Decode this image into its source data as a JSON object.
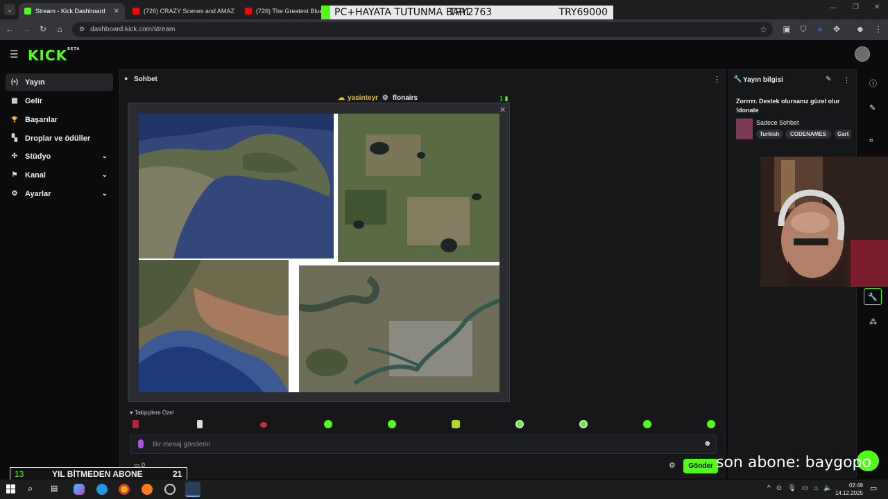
{
  "browser": {
    "tabs": [
      {
        "title": "Stream - Kick Dashboard",
        "active": true,
        "favicon_color": "#53fc18"
      },
      {
        "title": "(726) CRAZY Scenes and AMAZ",
        "active": false,
        "favicon_color": "#ff0000"
      },
      {
        "title": "(726) The Greatest Blues Ba",
        "active": false,
        "favicon_color": "#ff0000"
      }
    ],
    "url": "dashboard.kick.com/stream"
  },
  "overlay_top": {
    "left": "PC+HAYATA TUTUNMA BARI",
    "middle": "TRY2763",
    "right": "TRY69000"
  },
  "kick": {
    "logo": "KICK",
    "logo_badge": "BETA",
    "sidebar": [
      {
        "label": "Yayın",
        "icon": "broadcast-icon",
        "glyph": "(•)",
        "active": true,
        "expand": false
      },
      {
        "label": "Gelir",
        "icon": "revenue-icon",
        "glyph": "▦",
        "active": false,
        "expand": false
      },
      {
        "label": "Başarılar",
        "icon": "trophy-icon",
        "glyph": "🏆",
        "active": false,
        "expand": false
      },
      {
        "label": "Droplar ve ödüller",
        "icon": "drops-icon",
        "glyph": "▚",
        "active": false,
        "expand": false
      },
      {
        "label": "Stüdyo",
        "icon": "studio-icon",
        "glyph": "✣",
        "active": false,
        "expand": true
      },
      {
        "label": "Kanal",
        "icon": "channel-icon",
        "glyph": "⚑",
        "active": false,
        "expand": true
      },
      {
        "label": "Ayarlar",
        "icon": "settings-icon",
        "glyph": "⚙",
        "active": false,
        "expand": true
      }
    ],
    "chat": {
      "title": "Sohbet",
      "user1": "yasinteyr",
      "user2": "flonairs",
      "count": "1",
      "followers_only": "Takipçilere Özel",
      "input_placeholder": "Bir mesaj gönderin",
      "send_label": "Gönder",
      "points": "0"
    },
    "stream_info": {
      "title": "Yayın bilgisi",
      "stream_title": "Zorrrrr. Destek olursanız güzel olur !donate",
      "category": "Sadece Sohbet",
      "tags": [
        "Turkish",
        "CODENAMES",
        "Gart"
      ]
    }
  },
  "overlays": {
    "bottom_left": {
      "left": "13",
      "middle": "YIL BİTMEDEN ABONE",
      "right": "21"
    },
    "bottom_right": "son abone: baygopo"
  },
  "taskbar": {
    "time": "02:49",
    "date": "14.12.2025"
  },
  "colors": {
    "kick_green": "#53fc18",
    "panel_bg": "#161718",
    "page_bg": "#0b0b0c"
  }
}
